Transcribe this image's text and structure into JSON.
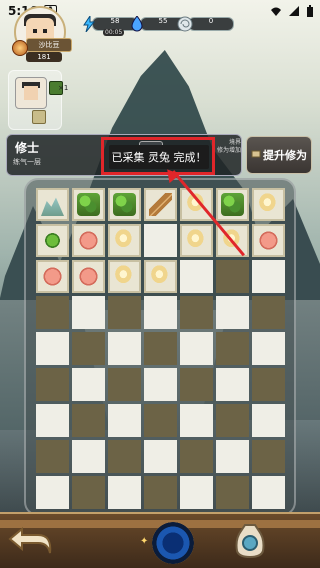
{
  "status_bar": {
    "time": "5:16",
    "sim_label": "A"
  },
  "player": {
    "name": "沙比豆",
    "level": "181"
  },
  "stats": [
    {
      "icon": "lightning-icon",
      "value": "58",
      "sub": "00:05"
    },
    {
      "icon": "flame-icon",
      "value": "55"
    },
    {
      "icon": "spiral-icon",
      "value": "0"
    }
  ],
  "character_card": {
    "count": "×1"
  },
  "cultivation": {
    "title": "修士",
    "sub": "练气一层",
    "info_line1": "境界",
    "info_line2": "修为增加",
    "raise_button": "提升修为"
  },
  "toast": {
    "message": "已采集 灵兔 完成！"
  },
  "grid": {
    "rows": 9,
    "cols": 7,
    "cells": [
      [
        "mount",
        "herb",
        "herb",
        "bamboo",
        "egg",
        "herb",
        "egg"
      ],
      [
        "leaf",
        "fish",
        "egg",
        "empty",
        "egg",
        "egg",
        "fish"
      ],
      [
        "fish",
        "fish",
        "egg",
        "egg",
        "empty",
        "dark",
        "empty"
      ],
      [
        "dark",
        "empty",
        "dark",
        "empty",
        "dark",
        "empty",
        "dark"
      ],
      [
        "empty",
        "dark",
        "empty",
        "dark",
        "empty",
        "dark",
        "empty"
      ],
      [
        "dark",
        "empty",
        "dark",
        "empty",
        "dark",
        "empty",
        "dark"
      ],
      [
        "empty",
        "dark",
        "empty",
        "dark",
        "empty",
        "dark",
        "empty"
      ],
      [
        "dark",
        "empty",
        "dark",
        "empty",
        "dark",
        "empty",
        "dark"
      ],
      [
        "empty",
        "dark",
        "empty",
        "dark",
        "empty",
        "dark",
        "empty"
      ]
    ]
  },
  "colors": {
    "highlight": "#e0262a",
    "panel": "#202426",
    "dark_cell": "#6c6346",
    "light_cell": "#efeee6"
  }
}
